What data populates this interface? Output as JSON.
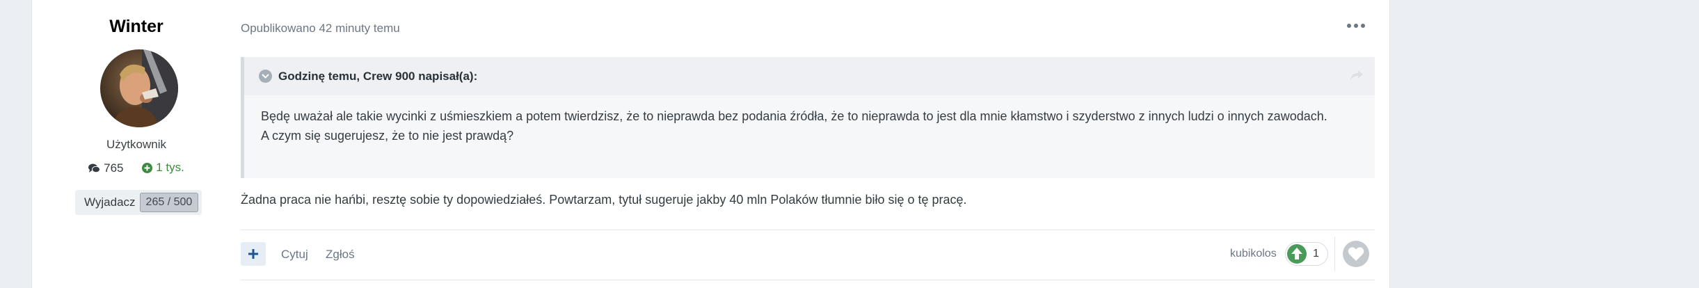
{
  "author": {
    "name": "Winter",
    "group": "Użytkownik",
    "posts_count": "765",
    "reputation": "1 tys.",
    "rank_title": "Wyjadacz",
    "rank_progress": "265 / 500"
  },
  "post": {
    "published": "Opublikowano 42 minuty temu",
    "quote": {
      "citation": "Godzinę temu, Crew 900 napisał(a):",
      "lines": [
        "Będę uważał ale takie wycinki z uśmieszkiem a potem twierdzisz, że to nieprawda bez podania źródła, że to nieprawda to jest dla mnie kłamstwo i szyderstwo z innych ludzi o innych zawodach.",
        "A czym się sugerujesz, że to nie jest prawdą?"
      ]
    },
    "message": "Żadna praca nie hańbi, resztę sobie ty dopowiedziałeś. Powtarzam, tytuł sugeruje jakby 40 mln Polaków tłumnie biło się o tę pracę."
  },
  "actions": {
    "add_label": "+",
    "quote_label": "Cytuj",
    "report_label": "Zgłoś"
  },
  "reactions": {
    "reacted_by": "kubikolos",
    "upvote_count": "1"
  },
  "colors": {
    "page_bg": "#ebeef2",
    "reputation_green": "#3b8a3f",
    "upvote_green": "#4a9b5a",
    "muted_text": "#6b7785"
  },
  "icons": {
    "posts": "comments-icon",
    "reputation": "plus-circle-icon",
    "more": "ellipsis-icon",
    "quote_toggle": "chevron-down-icon",
    "quote_share": "share-icon",
    "add": "plus-icon",
    "upvote": "arrow-up-icon",
    "react": "heart-icon"
  }
}
